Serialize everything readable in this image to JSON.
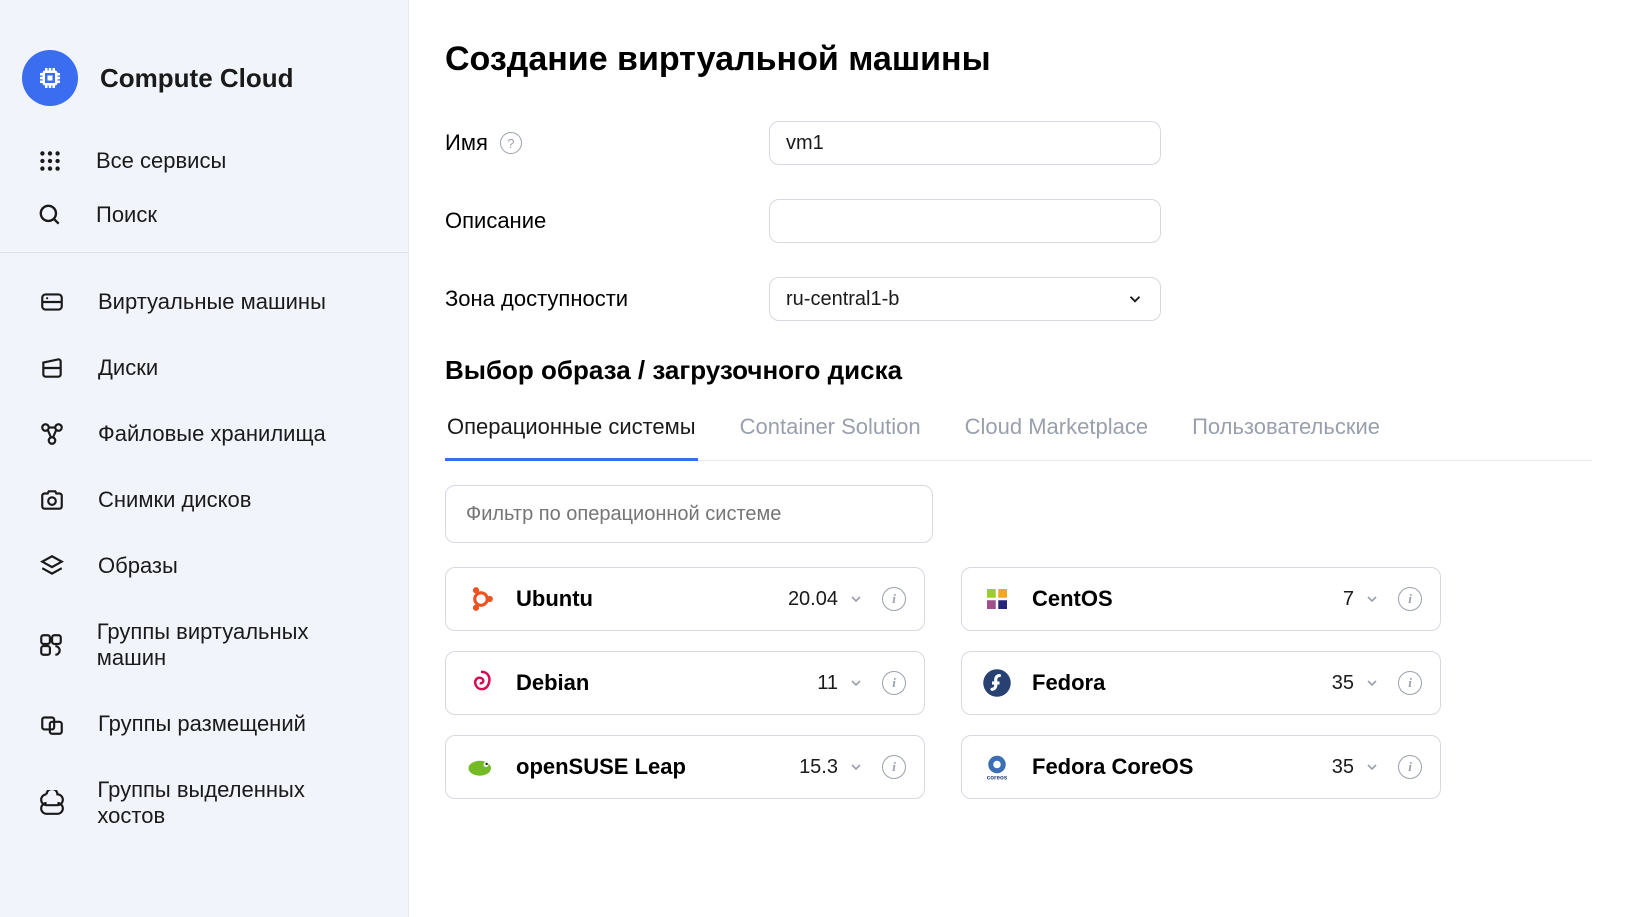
{
  "sidebar": {
    "brand": "Compute Cloud",
    "all_services": "Все сервисы",
    "search": "Поиск",
    "items": [
      "Виртуальные машины",
      "Диски",
      "Файловые хранилища",
      "Снимки дисков",
      "Образы",
      "Группы виртуальных машин",
      "Группы размещений",
      "Группы выделенных хостов"
    ]
  },
  "main": {
    "page_title": "Создание виртуальной машины",
    "name_label": "Имя",
    "name_value": "vm1",
    "description_label": "Описание",
    "description_value": "",
    "zone_label": "Зона доступности",
    "zone_value": "ru-central1-b",
    "image_section_title": "Выбор образа / загрузочного диска",
    "tabs": [
      "Операционные системы",
      "Container Solution",
      "Cloud Marketplace",
      "Пользовательские"
    ],
    "filter_placeholder": "Фильтр по операционной системе",
    "os": [
      {
        "name": "Ubuntu",
        "version": "20.04",
        "logo": "ubuntu"
      },
      {
        "name": "CentOS",
        "version": "7",
        "logo": "centos"
      },
      {
        "name": "Debian",
        "version": "11",
        "logo": "debian"
      },
      {
        "name": "Fedora",
        "version": "35",
        "logo": "fedora"
      },
      {
        "name": "openSUSE Leap",
        "version": "15.3",
        "logo": "opensuse"
      },
      {
        "name": "Fedora CoreOS",
        "version": "35",
        "logo": "fedora-coreos"
      }
    ]
  }
}
